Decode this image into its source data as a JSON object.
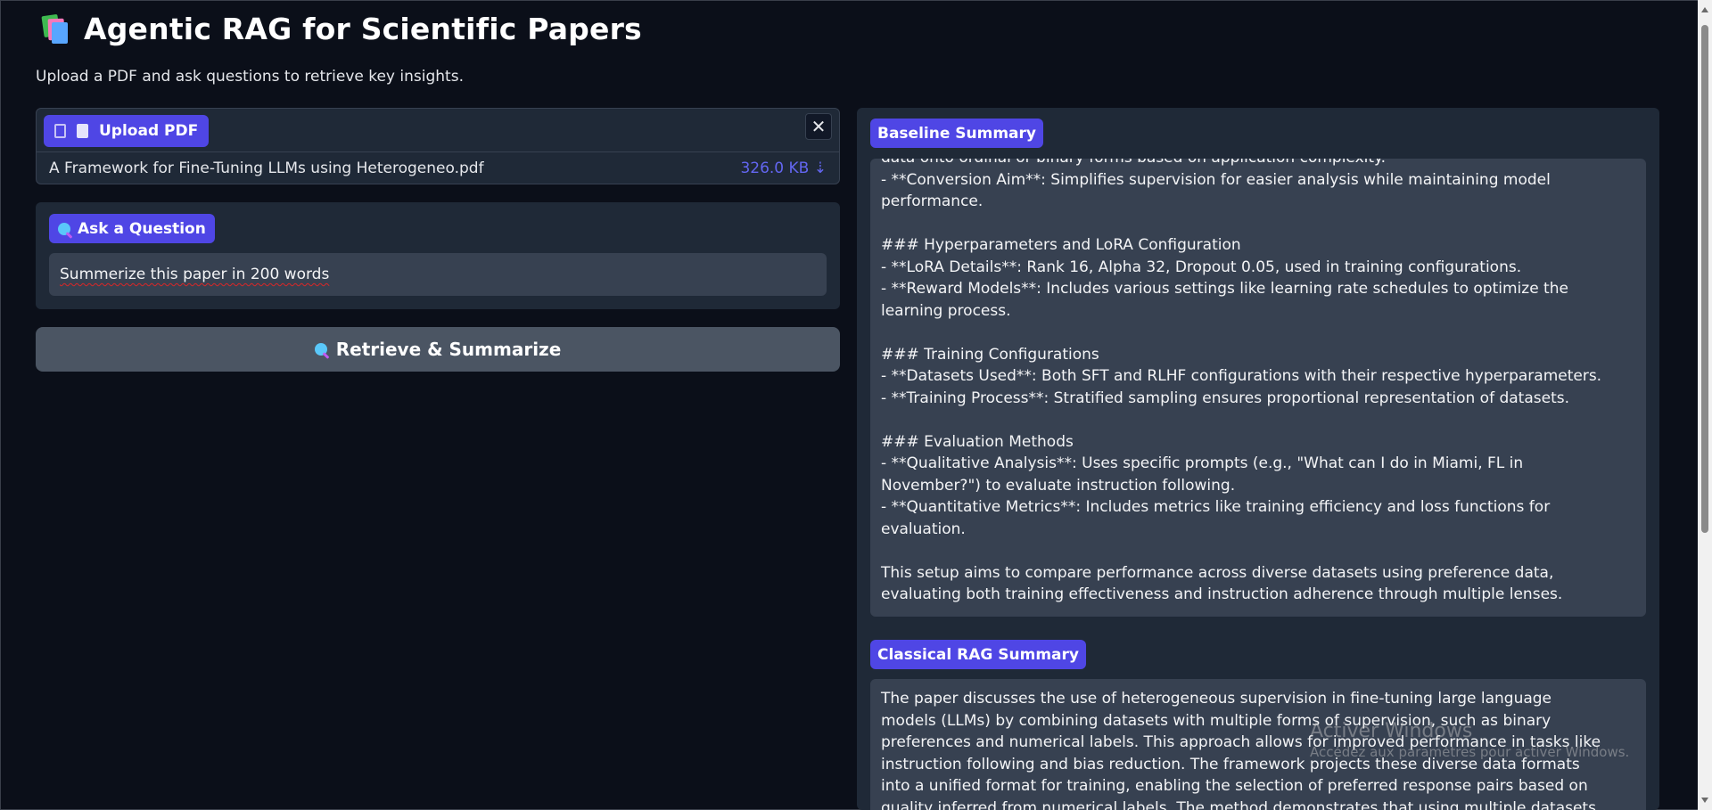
{
  "header": {
    "title": "Agentic RAG for Scientific Papers",
    "subtitle": "Upload a PDF and ask questions to retrieve key insights.",
    "logo_icon": "books-icon"
  },
  "upload": {
    "button_label": "Upload PDF",
    "file_name": "A Framework for Fine-Tuning LLMs using Heterogeneo.pdf",
    "file_size": "326.0 KB",
    "download_glyph": "⇣",
    "close_glyph": "✕"
  },
  "question": {
    "label": "Ask a Question",
    "value": "Summerize this paper in 200 words"
  },
  "retrieve_button": {
    "label": "Retrieve & Summarize"
  },
  "baseline": {
    "label": "Baseline Summary",
    "lines": [
      "data onto ordinal or binary forms based on application complexity.",
      "- **Conversion Aim**: Simplifies supervision for easier analysis while maintaining model",
      "performance.",
      "",
      "### Hyperparameters and LoRA Configuration",
      "- **LoRA Details**: Rank 16, Alpha 32, Dropout 0.05, used in training configurations.",
      "- **Reward Models**: Includes various settings like learning rate schedules to optimize the",
      "learning process.",
      "",
      "### Training Configurations",
      "- **Datasets Used**: Both SFT and RLHF configurations with their respective hyperparameters.",
      "- **Training Process**: Stratified sampling ensures proportional representation of datasets.",
      "",
      "### Evaluation Methods",
      "- **Qualitative Analysis**: Uses specific prompts (e.g., \"What can I do in Miami, FL in",
      "November?\") to evaluate instruction following.",
      "- **Quantitative Metrics**: Includes metrics like training efficiency and loss functions for",
      "evaluation.",
      "",
      "This setup aims to compare performance across diverse datasets using preference data,",
      "evaluating both training effectiveness and instruction adherence through multiple lenses."
    ]
  },
  "classical": {
    "label": "Classical RAG Summary",
    "lines": [
      "The paper discusses the use of heterogeneous supervision in fine-tuning large language",
      "models (LLMs) by combining datasets with multiple forms of supervision, such as binary",
      "preferences and numerical labels. This approach allows for improved performance in tasks like",
      "instruction following and bias reduction. The framework projects these diverse data formats",
      "into a unified format for training, enabling the selection of preferred response pairs based on",
      "quality inferred from numerical labels. The method demonstrates that using multiple datasets"
    ]
  },
  "watermark": {
    "title": "Activer Windows",
    "subtitle": "Accédez aux paramètres pour activer Windows."
  },
  "colors": {
    "background": "#0b0f19",
    "panel": "#1f2937",
    "accent": "#4f46e5",
    "input": "#374151",
    "button": "#4b5563"
  }
}
